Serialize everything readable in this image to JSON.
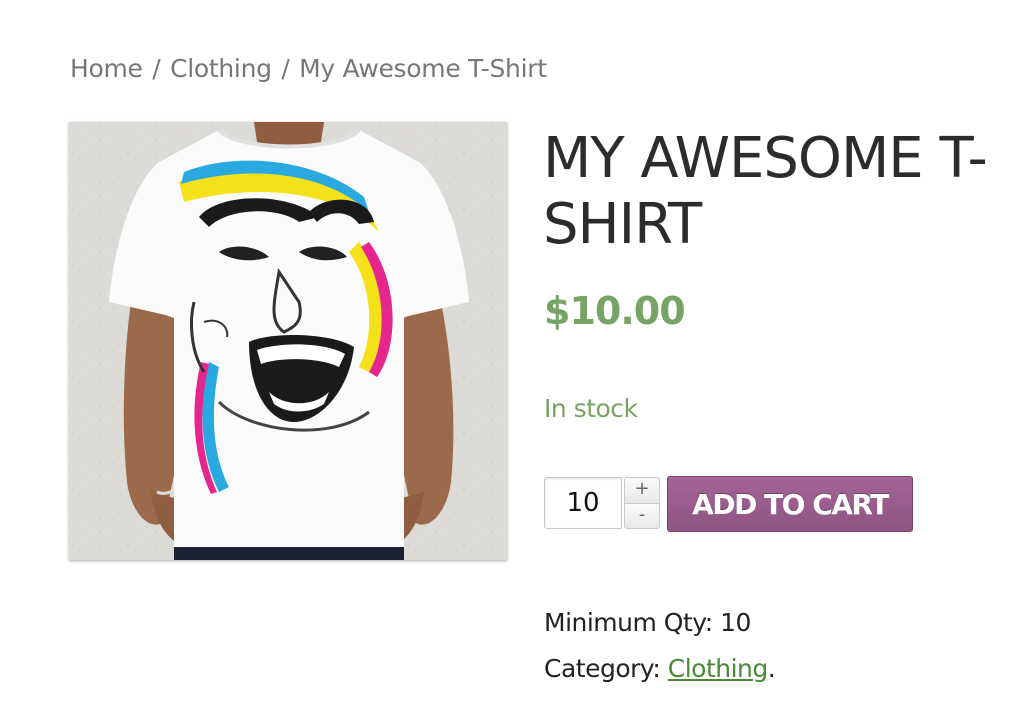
{
  "breadcrumb": {
    "home": "Home",
    "separator": "/",
    "category": "Clothing",
    "current": "My Awesome T-Shirt"
  },
  "product": {
    "image_alt": "White t-shirt with colorful face print",
    "title": "MY AWESOME T-SHIRT",
    "price": "$10.00",
    "stock": "In stock",
    "quantity_value": "10",
    "qty_plus": "+",
    "qty_minus": "-",
    "add_to_cart_label": "ADD TO CART",
    "min_qty_label": "Minimum Qty: 10",
    "category_label": "Category:",
    "category_link": "Clothing",
    "category_suffix": "."
  },
  "colors": {
    "price": "#77a464",
    "button": "#a46497",
    "link": "#4a8a36"
  }
}
